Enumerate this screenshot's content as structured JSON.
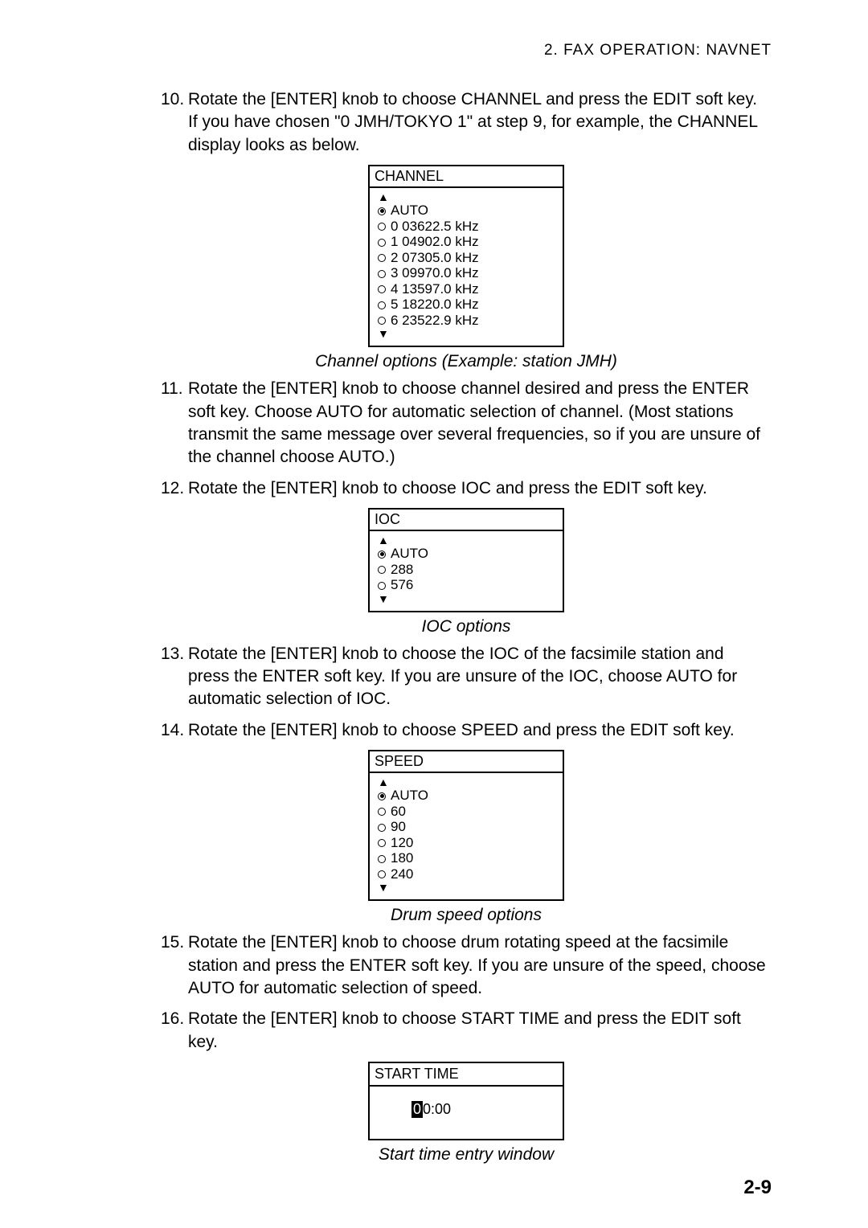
{
  "header": "2. FAX OPERATION: NAVNET",
  "steps": {
    "s10": {
      "num": "10.",
      "line1": "Rotate the [ENTER] knob to choose CHANNEL and press the EDIT soft key.",
      "line2": "If you have chosen \"0 JMH/TOKYO 1\" at step 9, for example, the CHANNEL",
      "line3": "display looks as below."
    },
    "s11": {
      "num": "11.",
      "line1": "Rotate the [ENTER] knob to choose channel desired and press the ENTER",
      "line2": "soft key. Choose AUTO for automatic selection of channel. (Most stations",
      "line3": "transmit the same message over several frequencies, so if you are unsure of",
      "line4": "the channel choose AUTO.)"
    },
    "s12": {
      "num": "12.",
      "line1": "Rotate the [ENTER] knob to choose IOC and press the EDIT soft key."
    },
    "s13": {
      "num": "13.",
      "line1": "Rotate the [ENTER] knob to choose the IOC of the facsimile station and",
      "line2": "press the ENTER soft key. If you are unsure of the IOC, choose AUTO for",
      "line3": "automatic selection of IOC."
    },
    "s14": {
      "num": "14.",
      "line1": "Rotate the [ENTER] knob to choose SPEED and press the EDIT soft key."
    },
    "s15": {
      "num": "15.",
      "line1": "Rotate the [ENTER] knob to choose drum rotating speed at the facsimile",
      "line2": "station and press the ENTER soft key. If you are unsure of the speed, choose",
      "line3": "AUTO for automatic selection of speed."
    },
    "s16": {
      "num": "16.",
      "line1": "Rotate the [ENTER] knob to choose START TIME and press the EDIT soft",
      "line2": "key."
    }
  },
  "channel_box": {
    "title": "CHANNEL",
    "options": [
      "AUTO",
      "0 03622.5 kHz",
      "1 04902.0 kHz",
      "2 07305.0 kHz",
      "3 09970.0 kHz",
      "4 13597.0 kHz",
      "5 18220.0 kHz",
      "6 23522.9 kHz"
    ],
    "caption": "Channel options (Example: station JMH)"
  },
  "ioc_box": {
    "title": "IOC",
    "options": [
      "AUTO",
      "288",
      "576"
    ],
    "caption": "IOC options"
  },
  "speed_box": {
    "title": "SPEED",
    "options": [
      "AUTO",
      "60",
      "90",
      "120",
      "180",
      "240"
    ],
    "caption": "Drum speed options"
  },
  "starttime_box": {
    "title": "START TIME",
    "value_inv": "0",
    "value_rest": "0:00",
    "caption": "Start time entry window"
  },
  "pagefoot": "2-9"
}
